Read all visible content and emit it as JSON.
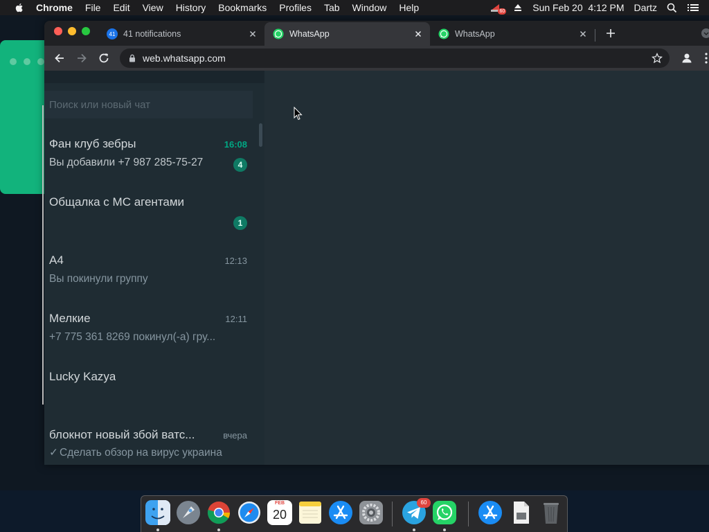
{
  "menubar": {
    "app_name": "Chrome",
    "items": [
      "File",
      "Edit",
      "View",
      "History",
      "Bookmarks",
      "Profiles",
      "Tab",
      "Window",
      "Help"
    ],
    "status_badge": "60",
    "datetime": "Sun Feb 20  4:12 PM",
    "user": "Dartz"
  },
  "browser": {
    "tabs": [
      {
        "title": "41 notifications",
        "favicon_text": "41",
        "active": false
      },
      {
        "title": "WhatsApp",
        "active": true
      },
      {
        "title": "WhatsApp",
        "active": false
      }
    ],
    "address_bar": {
      "url": "web.whatsapp.com"
    }
  },
  "whatsapp": {
    "search": {
      "placeholder": "Поиск или новый чат",
      "value": ""
    },
    "chats": [
      {
        "name": "Фан клуб зебры",
        "time": "16:08",
        "preview": "Вы добавили +7 987 285-75-27",
        "unread": "4"
      },
      {
        "name": "Общалка с MC агентами",
        "time": "",
        "preview": "",
        "unread": "1"
      },
      {
        "name": "A4",
        "time": "12:13",
        "preview": "Вы покинули группу",
        "unread": ""
      },
      {
        "name": "Мелкие",
        "time": "12:11",
        "preview": "+7 775 361 8269 покинул(-а) гру...",
        "unread": ""
      },
      {
        "name": "Lucky Kazya",
        "time": "",
        "preview": "",
        "unread": ""
      },
      {
        "name": "блокнот новый збой ватс...",
        "time": "вчера",
        "preview": "Сделать обзор на вирус украина",
        "unread": ""
      }
    ]
  },
  "dock": {
    "items": [
      "Finder",
      "Launchpad",
      "Google Chrome",
      "Safari",
      "Calendar",
      "Notes",
      "App Store",
      "System Preferences",
      "Telegram",
      "WhatsApp",
      "App Store Downloads",
      "Preview",
      "Trash"
    ],
    "calendar": {
      "month": "FEB",
      "day": "20"
    },
    "telegram_badge": "60"
  },
  "colors": {
    "wa_accent": "#00a884",
    "wa_panel": "#1f2c33",
    "wa_main": "#222e35",
    "chrome_frame": "#202124",
    "chrome_toolbar": "#35363a"
  }
}
